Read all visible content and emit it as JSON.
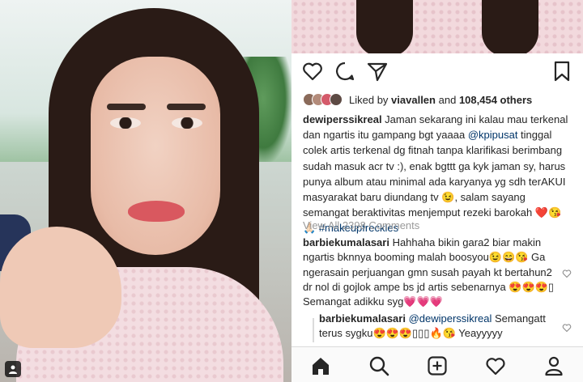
{
  "post": {
    "likes": {
      "prefix": "Liked by",
      "user": "viavallen",
      "conjunction": "and",
      "count": "108,454 others"
    },
    "caption": {
      "username": "dewiperssikreal",
      "text1": " Jaman sekarang ini kalau mau terkenal dan ngartis itu gampang bgt yaaaa ",
      "mention": "@kpipusat",
      "text2": " tinggal colek artis terkenal dg fitnah tanpa klarifikasi berimbang sudah masuk acr tv :), enak bgttt ga kyk jaman sy, harus punya album atau minimal ada karyanya yg sdh terAKUI masyarakat baru diundang tv 😉, salam sayang semangat beraktivitas menjemput rezeki barokah ❤️😘🙏🏻 ",
      "hashtag": "#makeupfreckles"
    },
    "view_all": "View All 2398 Comments",
    "comments": [
      {
        "username": "barbiekumalasari",
        "text": " Hahhaha bikin gara2 biar makin ngartis bknnya booming malah boosyou😉😄😘 Ga ngerasain perjuangan gmn susah payah kt bertahun2 dr nol di gojlok ampe bs jd artis sebenarnya 😍😍😍▯ Semangat adikku syg💗💗💗"
      },
      {
        "username": "barbiekumalasari",
        "mention": "@dewiperssikreal",
        "text": " Semangatt terus sygku😍😍😍▯▯▯🔥😘 Yeayyyyy"
      }
    ]
  },
  "icons": {
    "like": "heart-outline-icon",
    "comment": "speech-bubble-icon",
    "share": "paper-plane-icon",
    "save": "bookmark-icon",
    "nav": [
      "home-icon",
      "search-icon",
      "add-post-icon",
      "activity-heart-icon",
      "profile-icon"
    ]
  },
  "colors": {
    "link": "#003569",
    "muted": "#999999",
    "text": "#262626"
  }
}
